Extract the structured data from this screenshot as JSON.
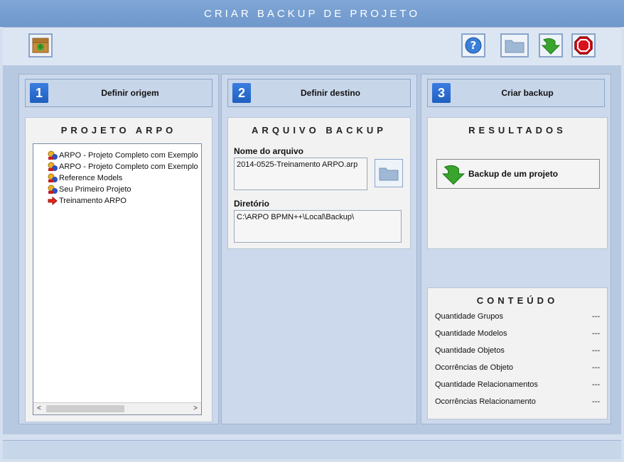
{
  "window": {
    "title": "CRIAR BACKUP DE PROJETO"
  },
  "toolbar": {
    "left_button": {
      "icon": "package-import-icon"
    },
    "right_buttons": [
      {
        "icon": "help-icon"
      },
      {
        "icon": "folder-icon"
      },
      {
        "icon": "green-arrow-down-icon"
      },
      {
        "icon": "stop-icon"
      }
    ]
  },
  "steps": [
    {
      "number": "1",
      "label": "Definir origem"
    },
    {
      "number": "2",
      "label": "Definir destino"
    },
    {
      "number": "3",
      "label": "Criar backup"
    }
  ],
  "origem": {
    "title": "PROJETO ARPO",
    "tree": [
      {
        "label": "ARPO - Projeto Completo com Exemplo",
        "icon": "project-icon"
      },
      {
        "label": "ARPO - Projeto Completo com Exemplo",
        "icon": "project-icon"
      },
      {
        "label": "Reference Models",
        "icon": "project-icon"
      },
      {
        "label": "Seu Primeiro Projeto",
        "icon": "project-icon"
      },
      {
        "label": "Treinamento ARPO",
        "icon": "red-arrow-icon"
      }
    ],
    "scroll_left": "<",
    "scroll_right": ">"
  },
  "destino": {
    "title": "ARQUIVO BACKUP",
    "filename_label": "Nome do arquivo",
    "filename_value": "2014-0525-Treinamento ARPO.arp",
    "directory_label": "Diretório",
    "directory_value": "C:\\ARPO BPMN++\\Local\\Backup\\"
  },
  "resultados": {
    "title": "RESULTADOS",
    "backup_button": "Backup de um projeto"
  },
  "conteudo": {
    "title": "CONTEÚDO",
    "rows": [
      {
        "label": "Quantidade Grupos",
        "value": "---"
      },
      {
        "label": "Quantidade Modelos",
        "value": "---"
      },
      {
        "label": "Quantidade Objetos",
        "value": "---"
      },
      {
        "label": "Ocorrências de Objeto",
        "value": "---"
      },
      {
        "label": "Quantidade Relacionamentos",
        "value": "---"
      },
      {
        "label": "Ocorrências Relacionamento",
        "value": "---"
      }
    ]
  },
  "colors": {
    "title_bar": "#7fa6d6",
    "step_number": "#1f5fc0",
    "selected_arrow": "#e8261c",
    "action_arrow": "#3aa52d"
  }
}
